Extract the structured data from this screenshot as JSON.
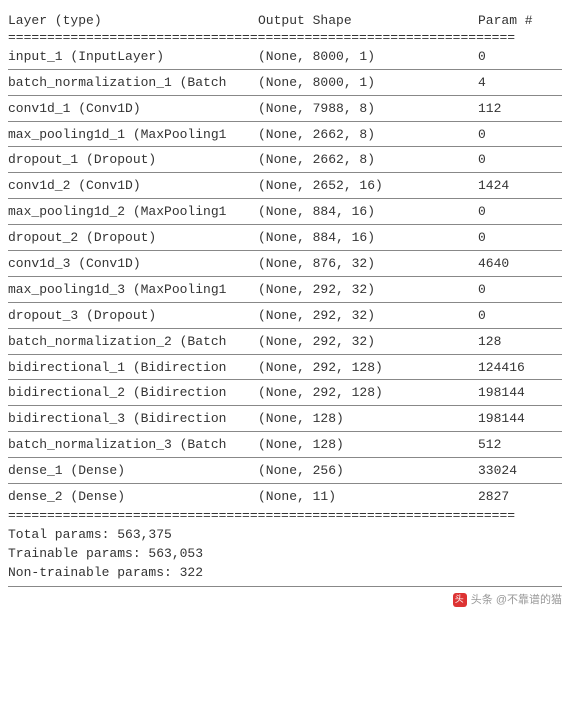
{
  "header": {
    "layer": "Layer (type)",
    "shape": "Output Shape",
    "param": "Param #"
  },
  "divider_double": "=================================================================",
  "rows": [
    {
      "layer": "input_1 (InputLayer)",
      "shape": "(None, 8000, 1)",
      "param": "0"
    },
    {
      "layer": "batch_normalization_1 (Batch",
      "shape": "(None, 8000, 1)",
      "param": "4"
    },
    {
      "layer": "conv1d_1 (Conv1D)",
      "shape": "(None, 7988, 8)",
      "param": "112"
    },
    {
      "layer": "max_pooling1d_1 (MaxPooling1",
      "shape": "(None, 2662, 8)",
      "param": "0"
    },
    {
      "layer": "dropout_1 (Dropout)",
      "shape": "(None, 2662, 8)",
      "param": "0"
    },
    {
      "layer": "conv1d_2 (Conv1D)",
      "shape": "(None, 2652, 16)",
      "param": "1424"
    },
    {
      "layer": "max_pooling1d_2 (MaxPooling1",
      "shape": "(None, 884, 16)",
      "param": "0"
    },
    {
      "layer": "dropout_2 (Dropout)",
      "shape": "(None, 884, 16)",
      "param": "0"
    },
    {
      "layer": "conv1d_3 (Conv1D)",
      "shape": "(None, 876, 32)",
      "param": "4640"
    },
    {
      "layer": "max_pooling1d_3 (MaxPooling1",
      "shape": "(None, 292, 32)",
      "param": "0"
    },
    {
      "layer": "dropout_3 (Dropout)",
      "shape": "(None, 292, 32)",
      "param": "0"
    },
    {
      "layer": "batch_normalization_2 (Batch",
      "shape": "(None, 292, 32)",
      "param": "128"
    },
    {
      "layer": "bidirectional_1 (Bidirection",
      "shape": "(None, 292, 128)",
      "param": "124416"
    },
    {
      "layer": "bidirectional_2 (Bidirection",
      "shape": "(None, 292, 128)",
      "param": "198144"
    },
    {
      "layer": "bidirectional_3 (Bidirection",
      "shape": "(None, 128)",
      "param": "198144"
    },
    {
      "layer": "batch_normalization_3 (Batch",
      "shape": "(None, 128)",
      "param": "512"
    },
    {
      "layer": "dense_1 (Dense)",
      "shape": "(None, 256)",
      "param": "33024"
    },
    {
      "layer": "dense_2 (Dense)",
      "shape": "(None, 11)",
      "param": "2827"
    }
  ],
  "summary": {
    "total": "Total params: 563,375",
    "trainable": "Trainable params: 563,053",
    "nontrainable": "Non-trainable params: 322"
  },
  "watermark": "头条 @不靠谱的猫",
  "chart_data": {
    "type": "table",
    "title": "Keras Model Summary",
    "columns": [
      "Layer (type)",
      "Output Shape",
      "Param #"
    ],
    "rows": [
      [
        "input_1 (InputLayer)",
        "(None, 8000, 1)",
        0
      ],
      [
        "batch_normalization_1 (BatchNormalization)",
        "(None, 8000, 1)",
        4
      ],
      [
        "conv1d_1 (Conv1D)",
        "(None, 7988, 8)",
        112
      ],
      [
        "max_pooling1d_1 (MaxPooling1D)",
        "(None, 2662, 8)",
        0
      ],
      [
        "dropout_1 (Dropout)",
        "(None, 2662, 8)",
        0
      ],
      [
        "conv1d_2 (Conv1D)",
        "(None, 2652, 16)",
        1424
      ],
      [
        "max_pooling1d_2 (MaxPooling1D)",
        "(None, 884, 16)",
        0
      ],
      [
        "dropout_2 (Dropout)",
        "(None, 884, 16)",
        0
      ],
      [
        "conv1d_3 (Conv1D)",
        "(None, 876, 32)",
        4640
      ],
      [
        "max_pooling1d_3 (MaxPooling1D)",
        "(None, 292, 32)",
        0
      ],
      [
        "dropout_3 (Dropout)",
        "(None, 292, 32)",
        0
      ],
      [
        "batch_normalization_2 (BatchNormalization)",
        "(None, 292, 32)",
        128
      ],
      [
        "bidirectional_1 (Bidirectional)",
        "(None, 292, 128)",
        124416
      ],
      [
        "bidirectional_2 (Bidirectional)",
        "(None, 292, 128)",
        198144
      ],
      [
        "bidirectional_3 (Bidirectional)",
        "(None, 128)",
        198144
      ],
      [
        "batch_normalization_3 (BatchNormalization)",
        "(None, 128)",
        512
      ],
      [
        "dense_1 (Dense)",
        "(None, 256)",
        33024
      ],
      [
        "dense_2 (Dense)",
        "(None, 11)",
        2827
      ]
    ],
    "totals": {
      "total_params": 563375,
      "trainable_params": 563053,
      "non_trainable_params": 322
    }
  }
}
